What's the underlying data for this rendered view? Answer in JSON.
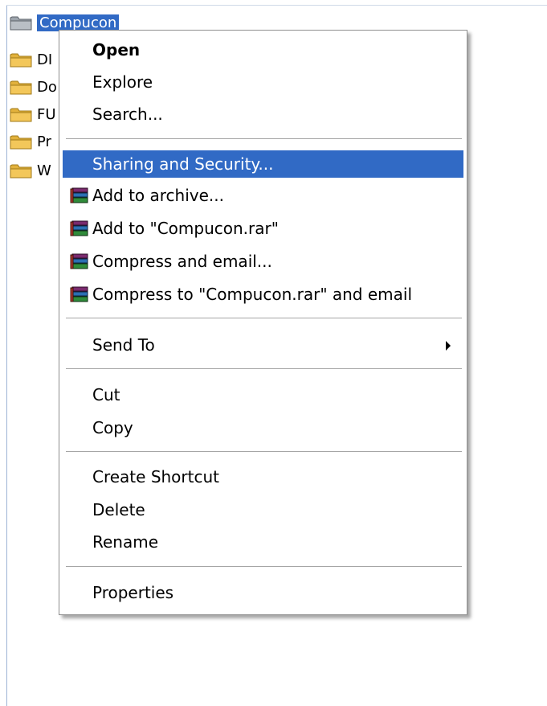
{
  "tree": {
    "items": [
      {
        "label": "Compucon",
        "selected": true
      },
      {
        "label": "DI"
      },
      {
        "label": "Do"
      },
      {
        "label": "FU"
      },
      {
        "label": "Pr"
      },
      {
        "label": "W"
      }
    ]
  },
  "context_menu": {
    "open": "Open",
    "explore": "Explore",
    "search": "Search...",
    "sharing": "Sharing and Security...",
    "add_archive": "Add to archive...",
    "add_to_rar": "Add to \"Compucon.rar\"",
    "compress_email": "Compress and email...",
    "compress_rar_email": "Compress to \"Compucon.rar\" and email",
    "send_to": "Send To",
    "cut": "Cut",
    "copy": "Copy",
    "create_shortcut": "Create Shortcut",
    "delete": "Delete",
    "rename": "Rename",
    "properties": "Properties"
  },
  "colors": {
    "highlight": "#316ac5",
    "folder": "#f3c75a"
  }
}
